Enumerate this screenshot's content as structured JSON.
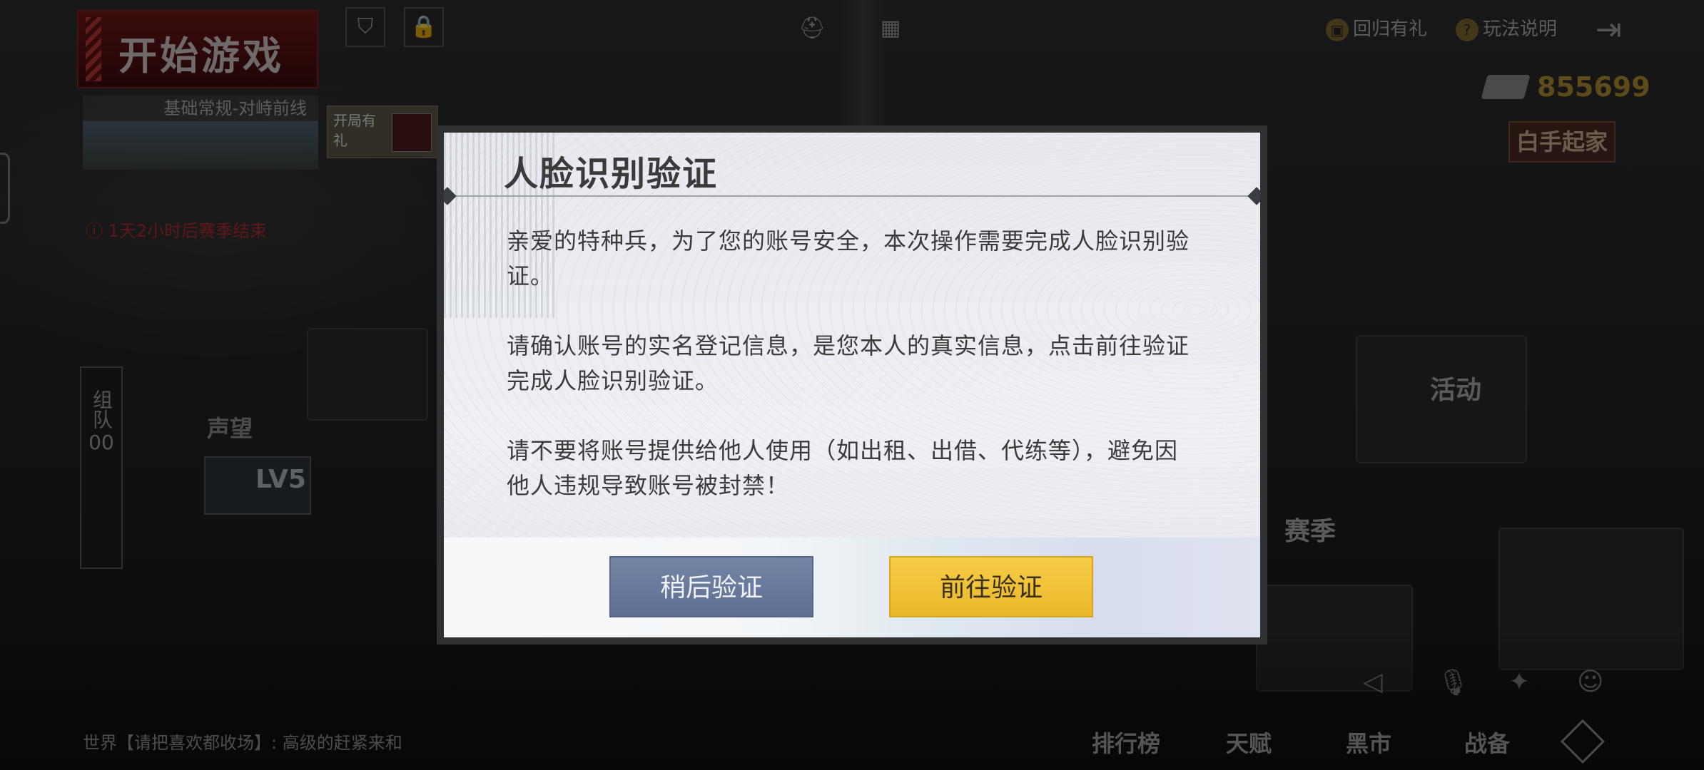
{
  "background": {
    "start_game": "开始游戏",
    "mode_label": "基础常规-对峙前线",
    "open_gift": "开局有礼",
    "countdown": "1天2小时后赛季结束",
    "return_gift": "回归有礼",
    "gameplay_info": "玩法说明",
    "currency_value": "855699",
    "brand_badge": "白手起家",
    "team_tab": "组队",
    "team_count": "00",
    "prestige": "声望",
    "level": "LV5",
    "activity": "活动",
    "season": "赛季",
    "chat_line": "世界【请把喜欢都收场】: 高级的赶紧来和",
    "bottom_nav": [
      "排行榜",
      "天赋",
      "黑市",
      "战备"
    ]
  },
  "dialog": {
    "title": "人脸识别验证",
    "paragraphs": [
      "亲爱的特种兵，为了您的账号安全，本次操作需要完成人脸识别验证。",
      "请确认账号的实名登记信息，是您本人的真实信息，点击前往验证完成人脸识别验证。",
      "请不要将账号提供给他人使用（如出租、出借、代练等），避免因他人违规导致账号被封禁！"
    ],
    "later_button": "稍后验证",
    "go_button": "前往验证"
  },
  "colors": {
    "later_button": "#6a7b9d",
    "go_button": "#f0c238",
    "overlay": "rgba(0,0,0,0.45)"
  }
}
